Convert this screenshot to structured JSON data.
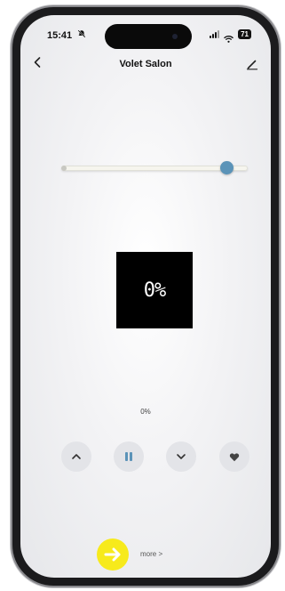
{
  "status_bar": {
    "time": "15:41",
    "battery": "71",
    "bell_icon": "bell-slash-icon",
    "signal_icon": "signal-bars-icon",
    "wifi_icon": "wifi-icon"
  },
  "nav": {
    "back_icon": "chevron-left-icon",
    "title": "Volet Salon",
    "edit_icon": "pencil-icon"
  },
  "slider": {
    "value_fraction": 0.92,
    "thumb_color": "#5b93b8"
  },
  "display": {
    "value": "0%"
  },
  "position_label": "0%",
  "controls": [
    {
      "name": "open-button",
      "icon": "chevron-up-icon"
    },
    {
      "name": "pause-button",
      "icon": "pause-icon",
      "color": "#5b93b8"
    },
    {
      "name": "close-button",
      "icon": "chevron-down-icon"
    },
    {
      "name": "favorite-button",
      "icon": "heart-icon"
    }
  ],
  "more": {
    "label": "more >",
    "arrow_icon": "arrow-right-icon",
    "highlight_color": "#f7ea1c"
  }
}
